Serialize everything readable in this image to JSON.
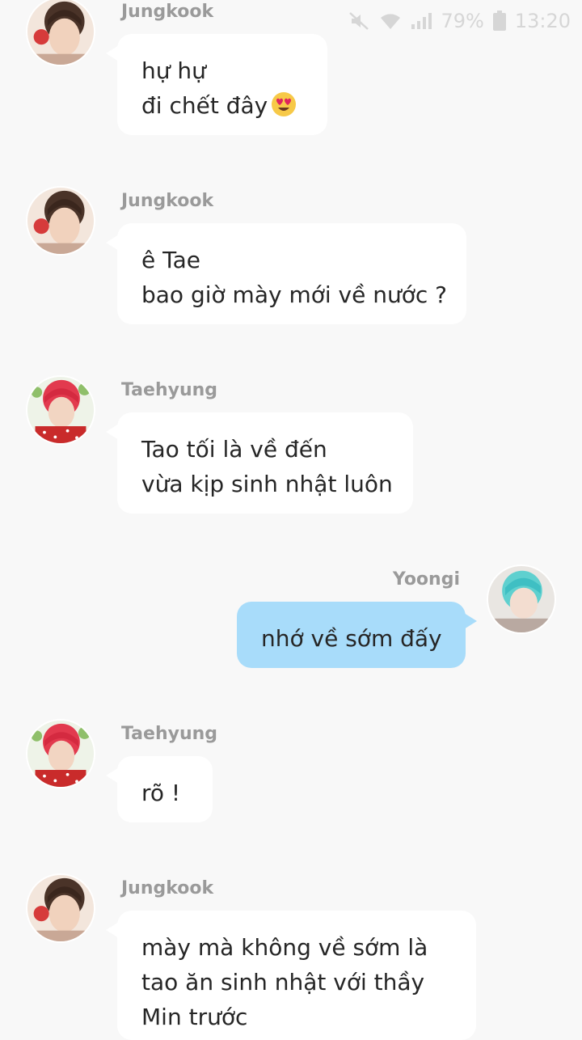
{
  "status_bar": {
    "battery": "79%",
    "time": "13:20"
  },
  "messages": [
    {
      "sender": "Jungkook",
      "lines": [
        "hự hự",
        "đi chết đây"
      ],
      "emoji": "heart-eyes-emoji"
    },
    {
      "sender": "Jungkook",
      "lines": [
        "ê Tae",
        "bao giờ mày mới về nước ?"
      ]
    },
    {
      "sender": "Taehyung",
      "lines": [
        "Tao tối là về đến",
        "vừa kịp sinh nhật luôn"
      ]
    },
    {
      "sender": "Yoongi",
      "lines": [
        "nhớ về sớm đấy"
      ]
    },
    {
      "sender": "Taehyung",
      "lines": [
        "rõ !"
      ]
    },
    {
      "sender": "Jungkook",
      "lines": [
        "mày mà không về sớm là",
        "tao ăn sinh nhật với thầy",
        "Min trước"
      ]
    }
  ],
  "colors": {
    "background": "#f8f8f8",
    "bubble_incoming": "#ffffff",
    "bubble_outgoing": "#a8dcfa",
    "name_text": "#9a9a9a"
  }
}
